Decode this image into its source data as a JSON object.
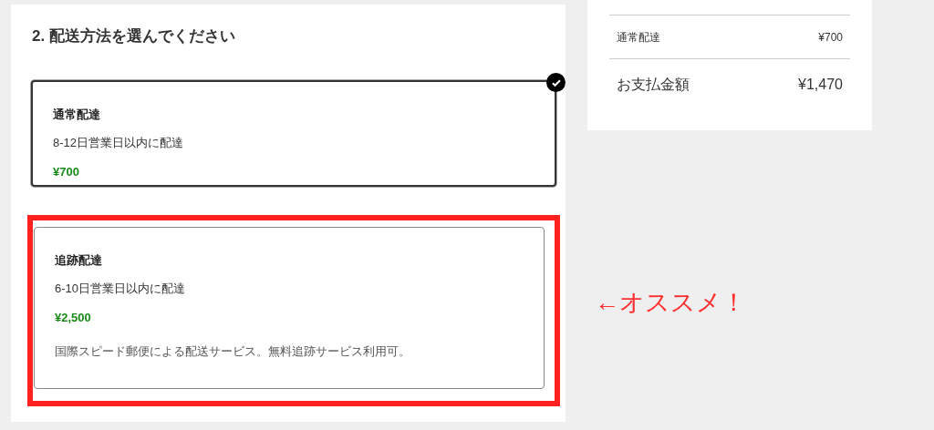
{
  "section_title": "2. 配送方法を選んでください",
  "options": [
    {
      "name": "通常配達",
      "delivery": "8-12日営業日以内に配達",
      "price": "¥700",
      "selected": true,
      "highlighted": false
    },
    {
      "name": "追跡配達",
      "delivery": "6-10日営業日以内に配達",
      "price": "¥2,500",
      "note": "国際スピード郵便による配送サービス。無料追跡サービス利用可。",
      "selected": false,
      "highlighted": true
    }
  ],
  "summary": {
    "rows": [
      {
        "label": "通常配達",
        "value": "¥700"
      }
    ],
    "total": {
      "label": "お支払金額",
      "value": "¥1,470"
    }
  },
  "annotation": "←オススメ！"
}
